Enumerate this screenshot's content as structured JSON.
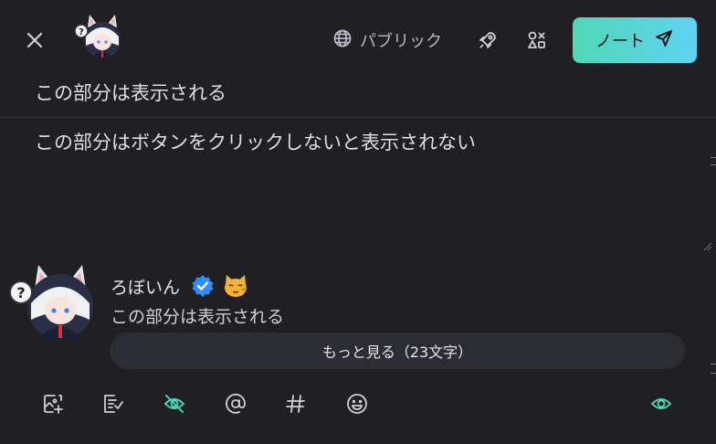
{
  "header": {
    "visibility_label": "パブリック",
    "post_label": "ノート"
  },
  "editor": {
    "cw_text": "この部分は表示される",
    "body_text": "この部分はボタンをクリックしないと表示されない"
  },
  "preview": {
    "user_name": "ろぼいん",
    "cw_text": "この部分は表示される",
    "show_more_label": "もっと見る（23文字）"
  },
  "icons": {
    "close": "close-icon",
    "visibility": "globe-icon",
    "reaction_accept": "rocket-icon",
    "widgets": "shapes-icon",
    "send": "send-icon",
    "attach": "image-add-icon",
    "poll": "poll-icon",
    "cw_toggle": "eye-off-icon",
    "mention": "at-icon",
    "hashtag": "hashtag-icon",
    "emoji": "emoji-icon",
    "preview_toggle": "eye-icon"
  },
  "colors": {
    "accent": "#52d7b7",
    "background": "#1f1f24",
    "verified": "#2f8ef5"
  }
}
